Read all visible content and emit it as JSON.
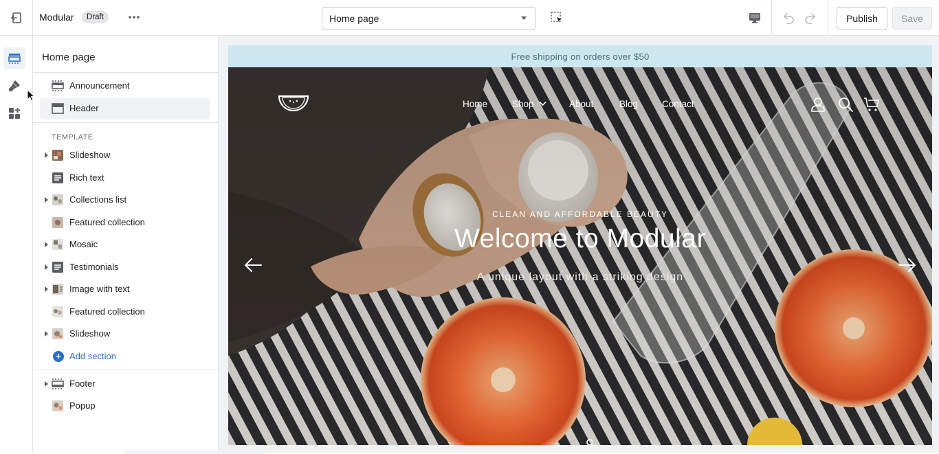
{
  "topbar": {
    "theme_name": "Modular",
    "status_badge": "Draft",
    "page_selector_value": "Home page",
    "publish_label": "Publish",
    "save_label": "Save"
  },
  "panel": {
    "title": "Home page",
    "template_label": "TEMPLATE",
    "header_sections": [
      {
        "label": "Announcement",
        "icon": "section-band-icon"
      },
      {
        "label": "Header",
        "icon": "header-icon",
        "selected": true
      }
    ],
    "template_sections": [
      {
        "label": "Slideshow",
        "icon": "image-thumb-icon",
        "expandable": true
      },
      {
        "label": "Rich text",
        "icon": "text-block-icon",
        "expandable": false
      },
      {
        "label": "Collections list",
        "icon": "image-thumb-icon",
        "expandable": true
      },
      {
        "label": "Featured collection",
        "icon": "image-thumb-icon",
        "expandable": false
      },
      {
        "label": "Mosaic",
        "icon": "image-thumb-icon",
        "expandable": true
      },
      {
        "label": "Testimonials",
        "icon": "text-block-icon",
        "expandable": true
      },
      {
        "label": "Image with text",
        "icon": "image-thumb-icon",
        "expandable": true
      },
      {
        "label": "Featured collection",
        "icon": "image-thumb-icon",
        "expandable": false
      },
      {
        "label": "Slideshow",
        "icon": "image-thumb-icon",
        "expandable": true
      }
    ],
    "add_section_label": "Add section",
    "footer_sections": [
      {
        "label": "Footer",
        "icon": "section-band-icon",
        "expandable": true
      },
      {
        "label": "Popup",
        "icon": "image-thumb-icon",
        "expandable": false
      }
    ]
  },
  "preview": {
    "announcement": "Free shipping on orders over $50",
    "nav": {
      "home": "Home",
      "shop": "Shop",
      "about": "About",
      "blog": "Blog",
      "contact": "Contact"
    },
    "hero": {
      "eyebrow": "CLEAN AND AFFORDABLE BEAUTY",
      "title": "Welcome to Modular",
      "subtitle": "A unique layout with a striking design"
    },
    "slide_count": 2,
    "active_slide": 2
  },
  "colors": {
    "accent": "#2c6ecb",
    "announcement_bg": "#cde7f0",
    "border": "#e1e3e5",
    "selected_bg": "#f1f2f3"
  }
}
